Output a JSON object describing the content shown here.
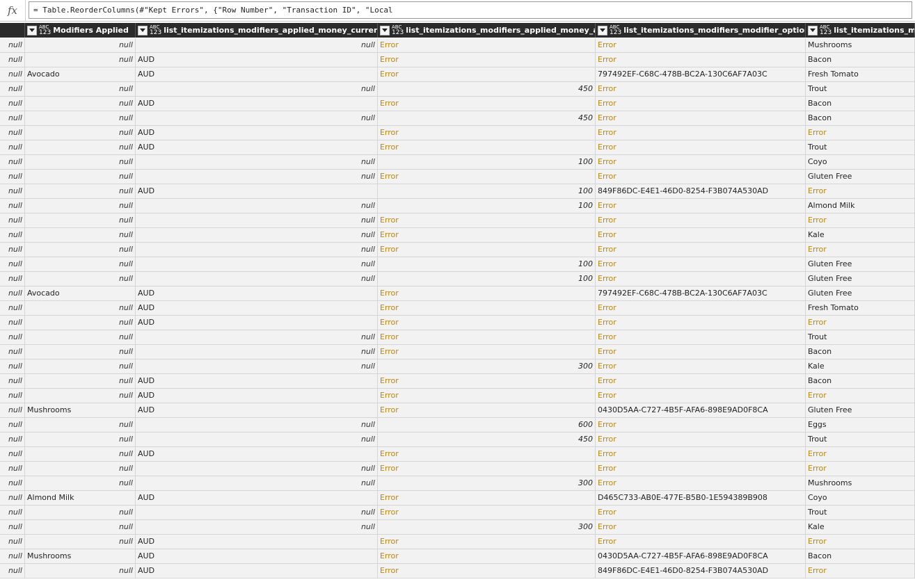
{
  "formula": {
    "fx_label": "fx",
    "text": "= Table.ReorderColumns(#\"Kept Errors\", {\"Row Number\", \"Transaction ID\", \"Local"
  },
  "columns": [
    {
      "label": "",
      "type_top": "",
      "type_bottom": "",
      "filter": false
    },
    {
      "label": "Modifiers Applied",
      "type_top": "ABC",
      "type_bottom": "123",
      "filter": true
    },
    {
      "label": "list_itemizations_modifiers_applied_money_currency_code",
      "type_top": "ABC",
      "type_bottom": "123",
      "filter": true
    },
    {
      "label": "list_itemizations_modifiers_applied_money_amount",
      "type_top": "ABC",
      "type_bottom": "123",
      "filter": true
    },
    {
      "label": "list_itemizations_modifiers_modifier_option_id",
      "type_top": "ABC",
      "type_bottom": "123",
      "filter": true
    },
    {
      "label": "list_itemizations_modifiers_",
      "type_top": "ABC",
      "type_bottom": "123",
      "filter": true
    }
  ],
  "rows": [
    [
      "null",
      "null",
      "null",
      "Error",
      "Error",
      "Mushrooms"
    ],
    [
      "null",
      "null",
      "AUD",
      "Error",
      "Error",
      "Bacon"
    ],
    [
      "null",
      "Avocado",
      "AUD",
      "Error",
      "797492EF-C68C-478B-BC2A-130C6AF7A03C",
      "Fresh Tomato"
    ],
    [
      "null",
      "null",
      "null",
      "450",
      "Error",
      "Trout"
    ],
    [
      "null",
      "null",
      "AUD",
      "Error",
      "Error",
      "Bacon"
    ],
    [
      "null",
      "null",
      "null",
      "450",
      "Error",
      "Bacon"
    ],
    [
      "null",
      "null",
      "AUD",
      "Error",
      "Error",
      "Error"
    ],
    [
      "null",
      "null",
      "AUD",
      "Error",
      "Error",
      "Trout"
    ],
    [
      "null",
      "null",
      "null",
      "100",
      "Error",
      "Coyo"
    ],
    [
      "null",
      "null",
      "null",
      "Error",
      "Error",
      "Gluten Free"
    ],
    [
      "null",
      "null",
      "AUD",
      "100",
      "849F86DC-E4E1-46D0-8254-F3B074A530AD",
      "Error"
    ],
    [
      "null",
      "null",
      "null",
      "100",
      "Error",
      "Almond Milk"
    ],
    [
      "null",
      "null",
      "null",
      "Error",
      "Error",
      "Error"
    ],
    [
      "null",
      "null",
      "null",
      "Error",
      "Error",
      "Kale"
    ],
    [
      "null",
      "null",
      "null",
      "Error",
      "Error",
      "Error"
    ],
    [
      "null",
      "null",
      "null",
      "100",
      "Error",
      "Gluten Free"
    ],
    [
      "null",
      "null",
      "null",
      "100",
      "Error",
      "Gluten Free"
    ],
    [
      "null",
      "Avocado",
      "AUD",
      "Error",
      "797492EF-C68C-478B-BC2A-130C6AF7A03C",
      "Gluten Free"
    ],
    [
      "null",
      "null",
      "AUD",
      "Error",
      "Error",
      "Fresh Tomato"
    ],
    [
      "null",
      "null",
      "AUD",
      "Error",
      "Error",
      "Error"
    ],
    [
      "null",
      "null",
      "null",
      "Error",
      "Error",
      "Trout"
    ],
    [
      "null",
      "null",
      "null",
      "Error",
      "Error",
      "Bacon"
    ],
    [
      "null",
      "null",
      "null",
      "300",
      "Error",
      "Kale"
    ],
    [
      "null",
      "null",
      "AUD",
      "Error",
      "Error",
      "Bacon"
    ],
    [
      "null",
      "null",
      "AUD",
      "Error",
      "Error",
      "Error"
    ],
    [
      "null",
      "Mushrooms",
      "AUD",
      "Error",
      "0430D5AA-C727-4B5F-AFA6-898E9AD0F8CA",
      "Gluten Free"
    ],
    [
      "null",
      "null",
      "null",
      "600",
      "Error",
      "Eggs"
    ],
    [
      "null",
      "null",
      "null",
      "450",
      "Error",
      "Trout"
    ],
    [
      "null",
      "null",
      "AUD",
      "Error",
      "Error",
      "Error"
    ],
    [
      "null",
      "null",
      "null",
      "Error",
      "Error",
      "Error"
    ],
    [
      "null",
      "null",
      "null",
      "300",
      "Error",
      "Mushrooms"
    ],
    [
      "null",
      "Almond Milk",
      "AUD",
      "Error",
      "D465C733-AB0E-477E-B5B0-1E594389B908",
      "Coyo"
    ],
    [
      "null",
      "null",
      "null",
      "Error",
      "Error",
      "Trout"
    ],
    [
      "null",
      "null",
      "null",
      "300",
      "Error",
      "Kale"
    ],
    [
      "null",
      "null",
      "AUD",
      "Error",
      "Error",
      "Error"
    ],
    [
      "null",
      "Mushrooms",
      "AUD",
      "Error",
      "0430D5AA-C727-4B5F-AFA6-898E9AD0F8CA",
      "Bacon"
    ],
    [
      "null",
      "null",
      "AUD",
      "Error",
      "849F86DC-E4E1-46D0-8254-F3B074A530AD",
      "Error"
    ]
  ],
  "colors": {
    "header_bg": "#2b2b2b",
    "error_text": "#b8860b",
    "cell_bg": "#f2f2f2"
  }
}
